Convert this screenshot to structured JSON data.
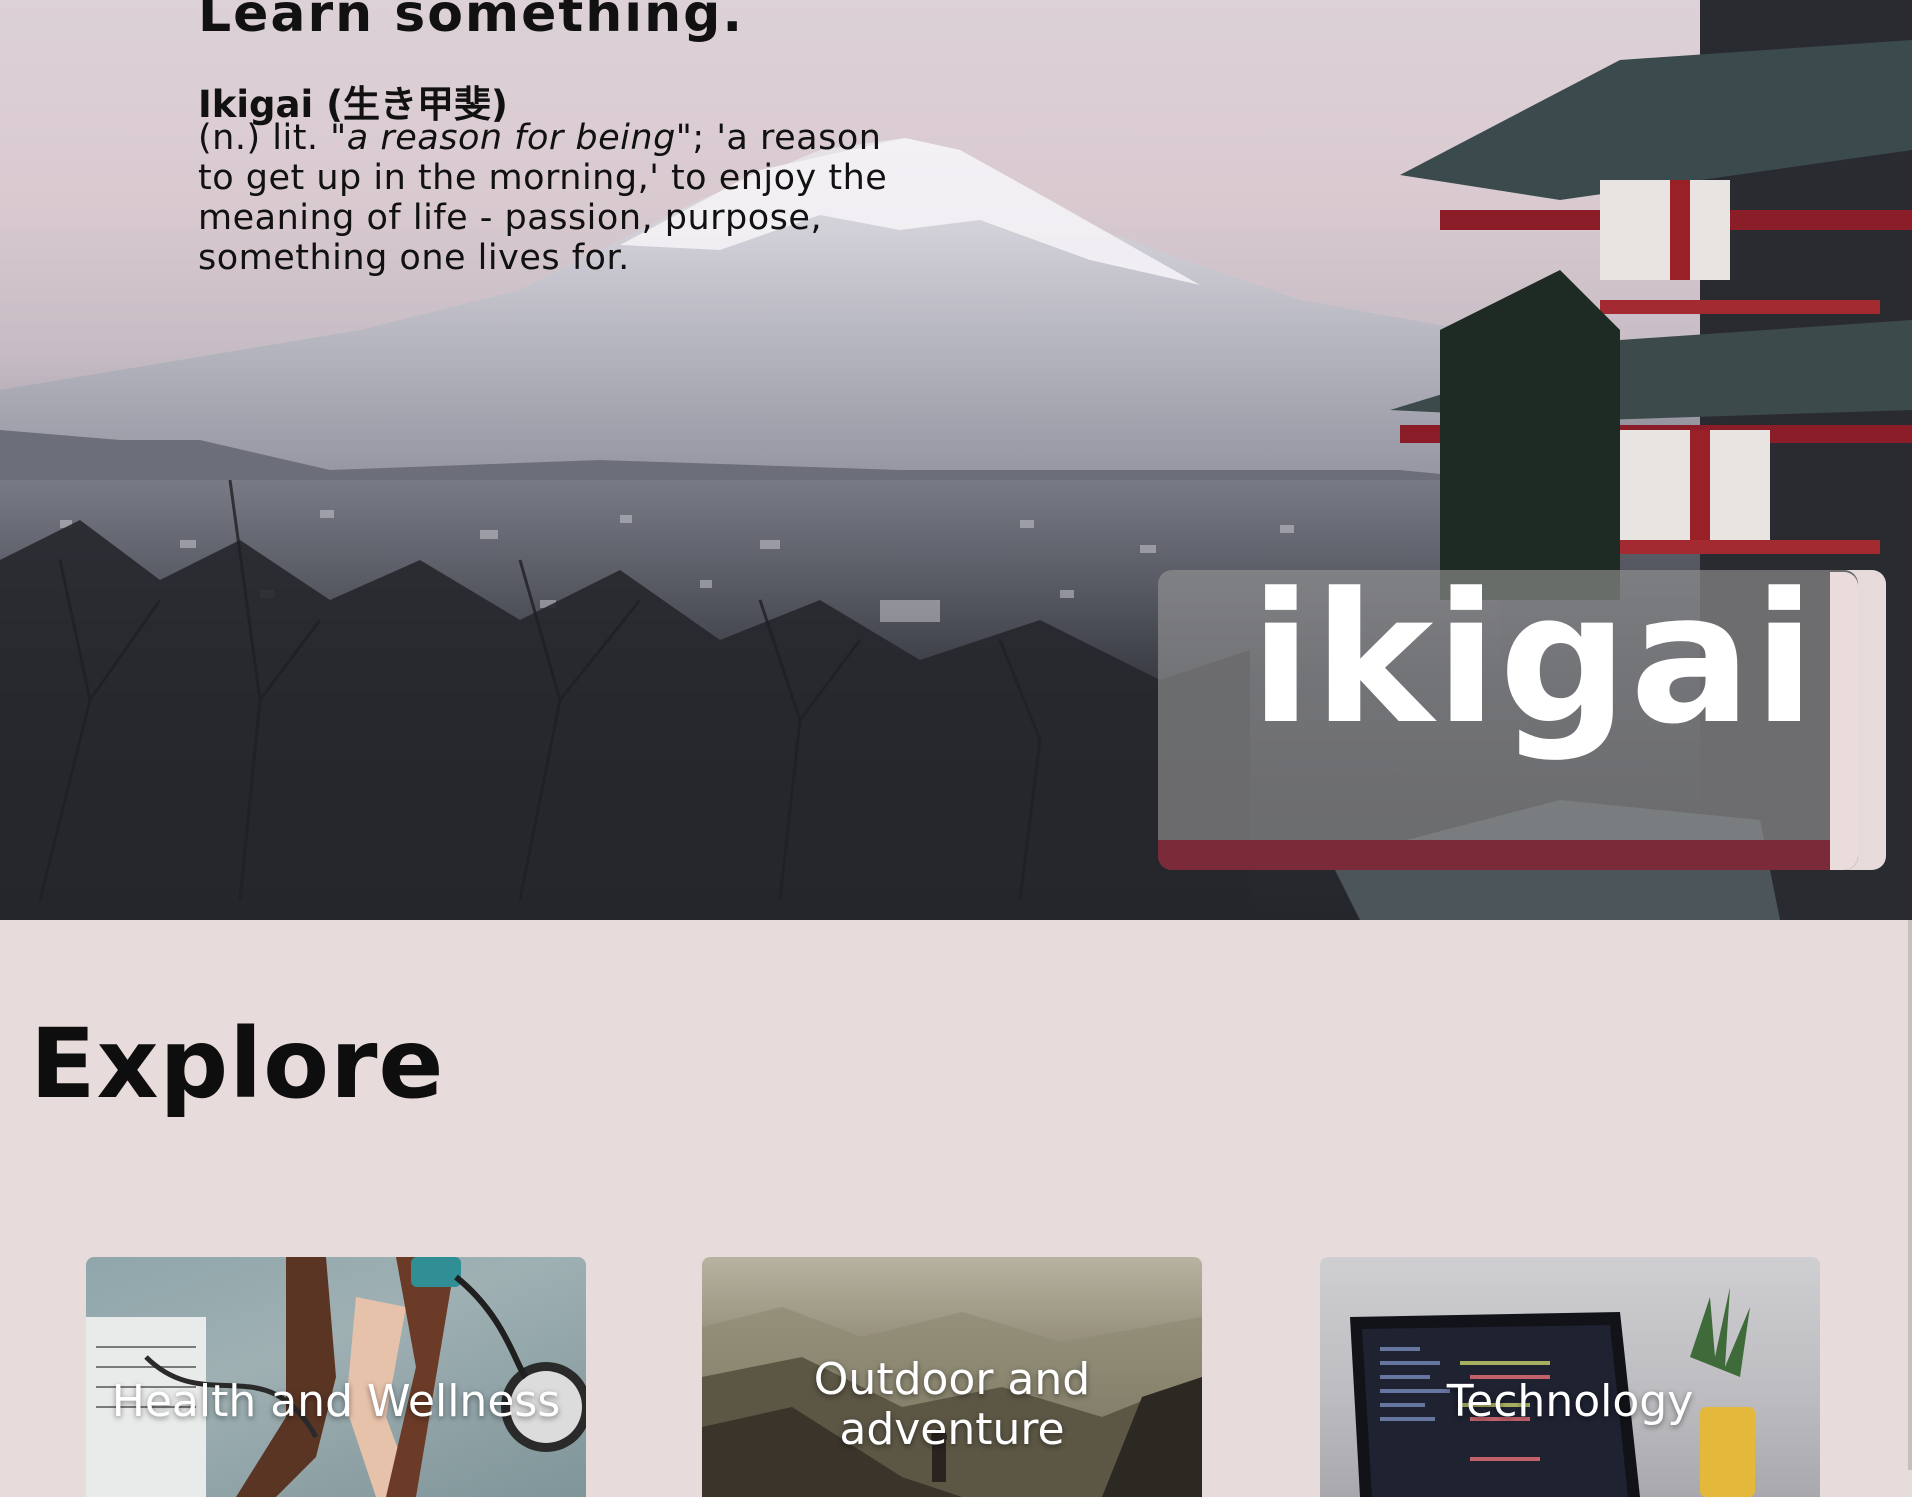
{
  "hero": {
    "heading": "Learn something.",
    "definition_term": "Ikigai (生き甲斐)",
    "definition_prefix": "(n.) lit. \"",
    "definition_italic": "a reason for being",
    "definition_rest": "\"; 'a reason to get up in the morning,' to enjoy the meaning of life - passion, purpose, something one lives for.",
    "logo_text": "ikigai",
    "accent_color": "#7b2a3a"
  },
  "explore": {
    "title": "Explore",
    "cards": [
      {
        "label": "Health and Wellness",
        "icon": "health-image"
      },
      {
        "label": "Outdoor and adventure",
        "icon": "mountain-image"
      },
      {
        "label": "Technology",
        "icon": "laptop-image"
      }
    ]
  }
}
